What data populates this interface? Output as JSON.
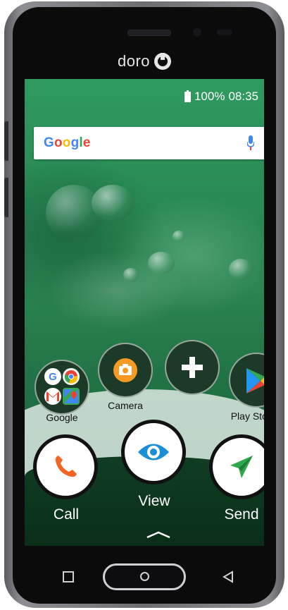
{
  "device": {
    "brand_text": "doro"
  },
  "status_bar": {
    "battery_percent": "100%",
    "time": "08:35"
  },
  "search_widget": {
    "logo_text": [
      "G",
      "o",
      "o",
      "g",
      "l",
      "e"
    ]
  },
  "apps": [
    {
      "label": "Google",
      "icon": "google-folder-icon"
    },
    {
      "label": "Camera",
      "icon": "camera-icon"
    },
    {
      "label": "",
      "icon": "add-icon"
    },
    {
      "label": "Play Store",
      "icon": "play-store-icon"
    }
  ],
  "actions": [
    {
      "label": "Call",
      "icon": "phone-icon",
      "color": "#f26522"
    },
    {
      "label": "View",
      "icon": "eye-icon",
      "color": "#1a8fd6"
    },
    {
      "label": "Send",
      "icon": "send-icon",
      "color": "#2da84a"
    }
  ],
  "nav": {
    "recent": "recent-apps-icon",
    "home": "home-icon",
    "back": "back-icon"
  },
  "colors": {
    "wallpaper_green": "#2b8452",
    "camera_orange": "#f59a23"
  }
}
